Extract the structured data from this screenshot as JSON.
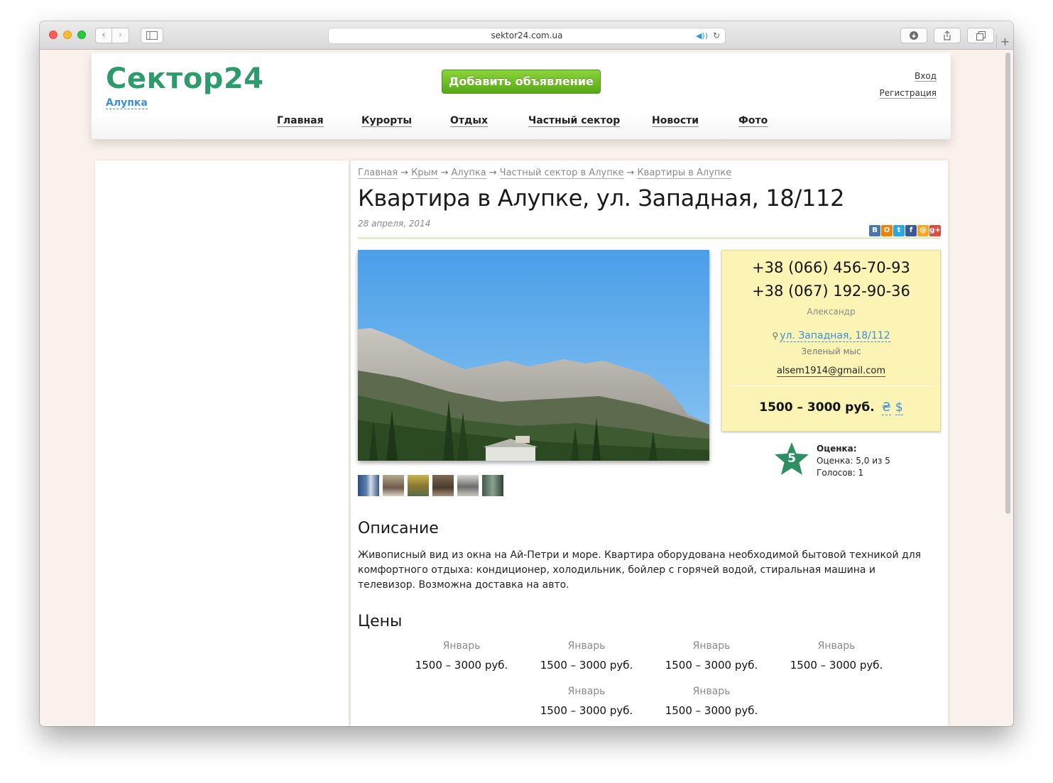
{
  "browser": {
    "url": "sektor24.com.ua"
  },
  "header": {
    "logo_main": "Сектор",
    "logo_num": "24",
    "city": "Алупка",
    "add_button": "Добавить объявление",
    "login": "Вход",
    "register": "Регистрация",
    "nav": [
      "Главная",
      "Курорты",
      "Отдых",
      "Частный сектор",
      "Новости",
      "Фото"
    ]
  },
  "breadcrumb": [
    "Главная",
    "Крым",
    "Алупка",
    "Частный сектор в Алупке",
    "Квартиры в Алупке"
  ],
  "listing": {
    "title": "Квартира в Алупке, ул. Западная, 18/112",
    "date": "28 апреля, 2014",
    "share_icons": [
      "vk-icon",
      "odnoklassniki-icon",
      "twitter-icon",
      "facebook-icon",
      "mailru-icon",
      "googleplus-icon"
    ]
  },
  "contact": {
    "phone1": "+38 (066) 456-70-93",
    "phone2": "+38 (067) 192-90-36",
    "owner": "Александр",
    "address": "ул. Западная, 18/112",
    "district": "Зеленый мыс",
    "email": "alsem1914@gmail.com",
    "price": "1500 – 3000 руб.",
    "currency_uah": "₴",
    "currency_usd": "$"
  },
  "rating": {
    "score_badge": "5",
    "label": "Оценка:",
    "score_text": "Оценка: 5,0 из 5",
    "votes": "Голосов: 1"
  },
  "description": {
    "heading": "Описание",
    "text": "Живописный вид из окна на Ай-Петри и море. Квартира оборудована необходимой бытовой техникой для комфортного отдыха: кондиционер, холодильник, бойлер с горячей водой, стиральная машина и телевизор. Возможна доставка на авто."
  },
  "prices": {
    "heading": "Цены",
    "rows": [
      {
        "month": "Январь",
        "range": "1500 – 3000 руб."
      },
      {
        "month": "Январь",
        "range": "1500 – 3000 руб."
      },
      {
        "month": "Январь",
        "range": "1500 – 3000 руб."
      },
      {
        "month": "Январь",
        "range": "1500 – 3000 руб."
      },
      {
        "month": "Январь",
        "range": "1500 – 3000 руб."
      },
      {
        "month": "Январь",
        "range": "1500 – 3000 руб."
      }
    ]
  },
  "colors": {
    "brand_green": "#2d9b6c",
    "accent_blue": "#3b8fd9",
    "button_green": "#6cbd28",
    "contact_bg": "#fbf4b5"
  }
}
